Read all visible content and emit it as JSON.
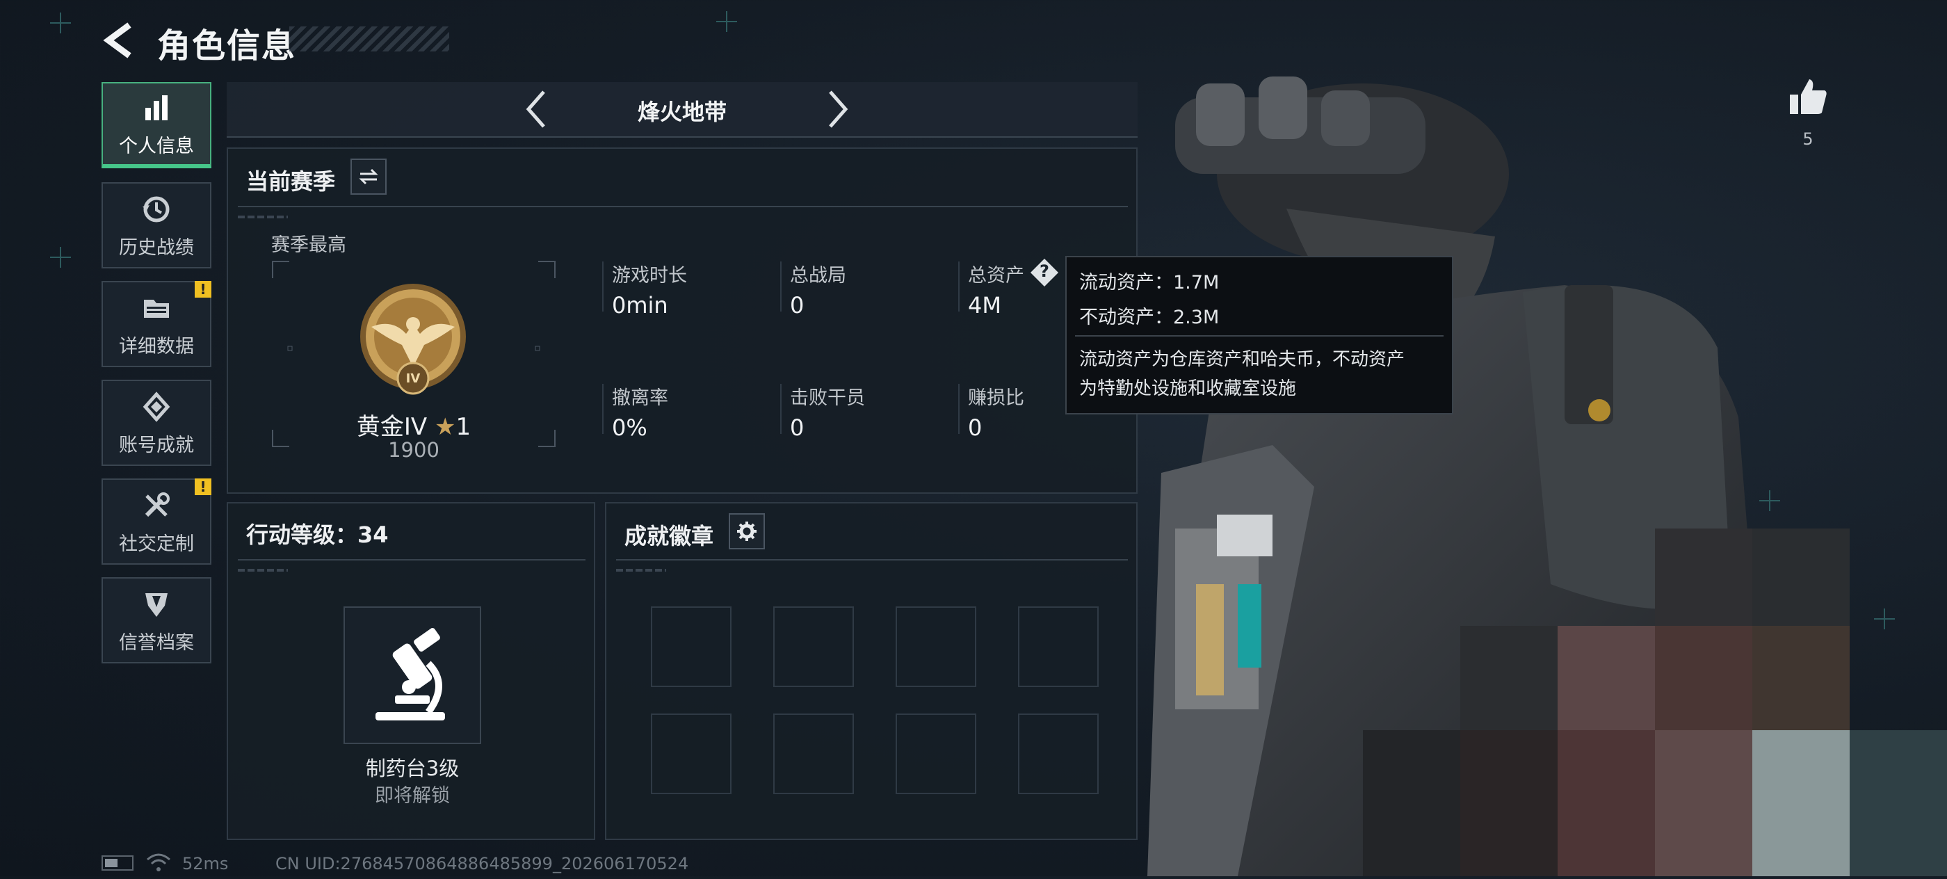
{
  "header": {
    "title": "角色信息"
  },
  "sidebar": {
    "items": [
      {
        "label": "个人信息",
        "icon": "bar-chart-icon",
        "active": true,
        "alert": false
      },
      {
        "label": "历史战绩",
        "icon": "history-icon",
        "active": false,
        "alert": false
      },
      {
        "label": "详细数据",
        "icon": "folder-icon",
        "active": false,
        "alert": true
      },
      {
        "label": "账号成就",
        "icon": "achievement-icon",
        "active": false,
        "alert": false
      },
      {
        "label": "社交定制",
        "icon": "tools-icon",
        "active": false,
        "alert": true
      },
      {
        "label": "信誉档案",
        "icon": "shield-icon",
        "active": false,
        "alert": false
      }
    ],
    "alert_mark": "!"
  },
  "mode_bar": {
    "label": "烽火地带"
  },
  "season": {
    "title": "当前赛季",
    "best_label": "赛季最高",
    "rank_name": "黄金IV",
    "rank_stars": "1",
    "rank_score": "1900",
    "medal_numeral": "IV",
    "stats": [
      {
        "label": "游戏时长",
        "value": "0min"
      },
      {
        "label": "总战局",
        "value": "0"
      },
      {
        "label": "总资产",
        "value": "4M"
      },
      {
        "label": "撤离率",
        "value": "0%"
      },
      {
        "label": "击败干员",
        "value": "0"
      },
      {
        "label": "赚损比",
        "value": "0"
      }
    ],
    "help_mark": "?"
  },
  "tooltip": {
    "line1": "流动资产：1.7M",
    "line2": "不动资产：2.3M",
    "desc1": "流动资产为仓库资产和哈夫币，不动资产",
    "desc2": "为特勤处设施和收藏室设施"
  },
  "action_level": {
    "title": "行动等级：34",
    "unlock_name": "制药台3级",
    "unlock_status": "即将解锁"
  },
  "badges": {
    "title": "成就徽章",
    "slots": 8
  },
  "like": {
    "count": "5"
  },
  "status_bar": {
    "ping": "52ms",
    "uid": "CN UID:27684570864886485899_202606170524"
  },
  "colors": {
    "accent_green": "#46c78a",
    "alert_yellow": "#f0c022",
    "gold": "#c9a15a"
  }
}
